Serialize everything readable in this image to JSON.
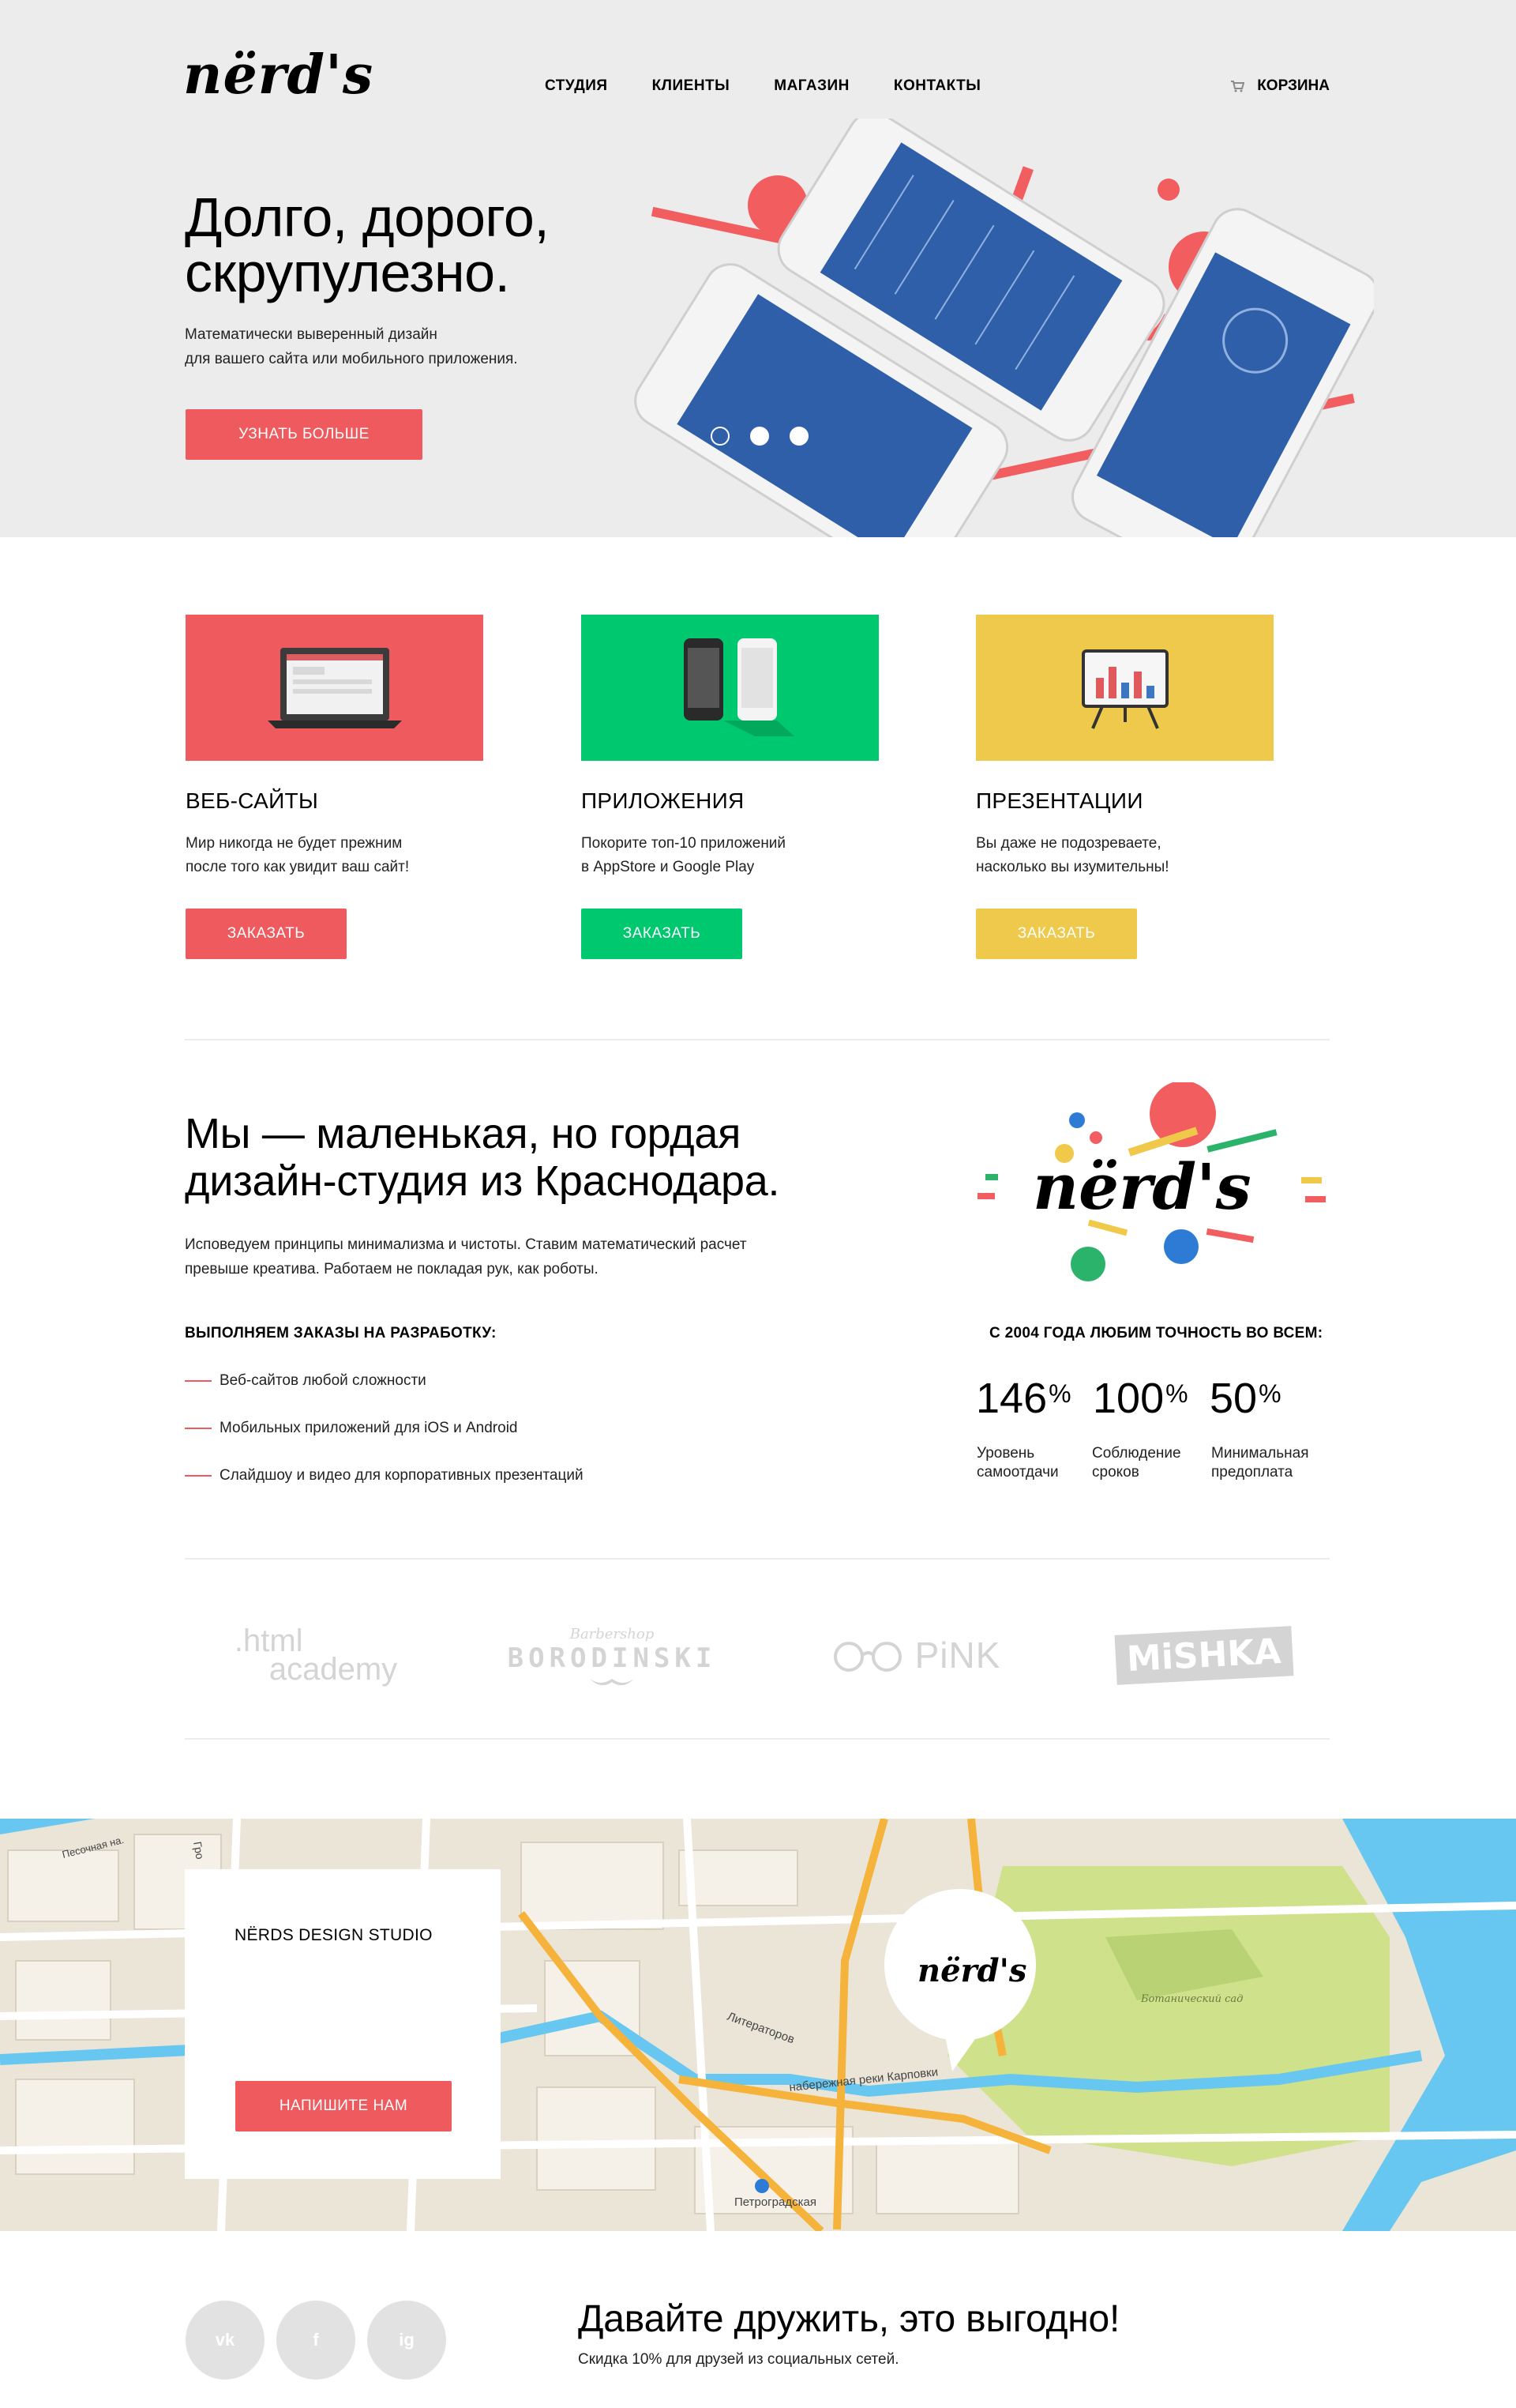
{
  "header": {
    "logo": "nërd's",
    "nav": [
      "СТУДИЯ",
      "КЛИЕНТЫ",
      "МАГАЗИН",
      "КОНТАКТЫ"
    ],
    "cart_label": "КОРЗИНА"
  },
  "hero": {
    "title_line1": "Долго, дорого,",
    "title_line2": "скрупулезно.",
    "text_line1": "Математически выверенный дизайн",
    "text_line2": "для вашего сайта или мобильного приложения.",
    "button": "УЗНАТЬ БОЛЬШЕ",
    "slider_active_index": 0,
    "slider_count": 3
  },
  "services": [
    {
      "title": "ВЕБ-САЙТЫ",
      "text_line1": "Мир никогда не будет прежним",
      "text_line2": "после того как увидит ваш сайт!",
      "button": "ЗАКАЗАТЬ",
      "color": "#ee5a5e"
    },
    {
      "title": "ПРИЛОЖЕНИЯ",
      "text_line1": "Покорите топ-10 приложений",
      "text_line2": "в AppStore и Google Play",
      "button": "ЗАКАЗАТЬ",
      "color": "#00c86e"
    },
    {
      "title": "ПРЕЗЕНТАЦИИ",
      "text_line1": "Вы даже не подозреваете,",
      "text_line2": "насколько вы изумительны!",
      "button": "ЗАКАЗАТЬ",
      "color": "#eec94c"
    }
  ],
  "about": {
    "title_line1": "Мы — маленькая, но гордая",
    "title_line2": "дизайн-студия из Краснодара.",
    "text_line1": "Исповедуем принципы минимализма и чистоты. Ставим математический расчет",
    "text_line2": "превыше креатива. Работаем не покладая рук, как роботы.",
    "list_heading": "ВЫПОЛНЯЕМ ЗАКАЗЫ НА РАЗРАБОТКУ:",
    "list": [
      "Веб-сайтов любой сложности",
      "Мобильных приложений для iOS и Android",
      "Слайдшоу и видео для корпоративных презентаций"
    ],
    "stats_heading": "С 2004 ГОДА ЛЮБИМ ТОЧНОСТЬ ВО ВСЕМ:",
    "stats": [
      {
        "value": "146",
        "unit": "%",
        "label_line1": "Уровень",
        "label_line2": "самоотдачи"
      },
      {
        "value": "100",
        "unit": "%",
        "label_line1": "Соблюдение",
        "label_line2": "сроков"
      },
      {
        "value": "50",
        "unit": "%",
        "label_line1": "Минимальная",
        "label_line2": "предоплата"
      }
    ]
  },
  "clients": [
    {
      "line1": ".html",
      "line2": "academy"
    },
    {
      "line1": "Barbershop",
      "line2": "BORODINSKI"
    },
    {
      "line1": "PiNK"
    },
    {
      "line1": "MiSHKA"
    }
  ],
  "map": {
    "studio": "NЁRDS DESIGN STUDIO",
    "button": "НАПИШИТЕ НАМ",
    "streets": [
      "Песочная на.",
      "Гро",
      "Литераторов",
      "набережная реки Карповки",
      "Петроградская",
      "Ботанический сад"
    ]
  },
  "footer": {
    "social": [
      "vk",
      "f",
      "ig"
    ],
    "title": "Давайте дружить, это выгодно!",
    "text": "Скидка 10% для друзей из социальных сетей."
  },
  "colors": {
    "accent_red": "#ee5a5e",
    "accent_green": "#00c86e",
    "accent_yellow": "#eec94c",
    "hero_bg": "#ececec"
  }
}
